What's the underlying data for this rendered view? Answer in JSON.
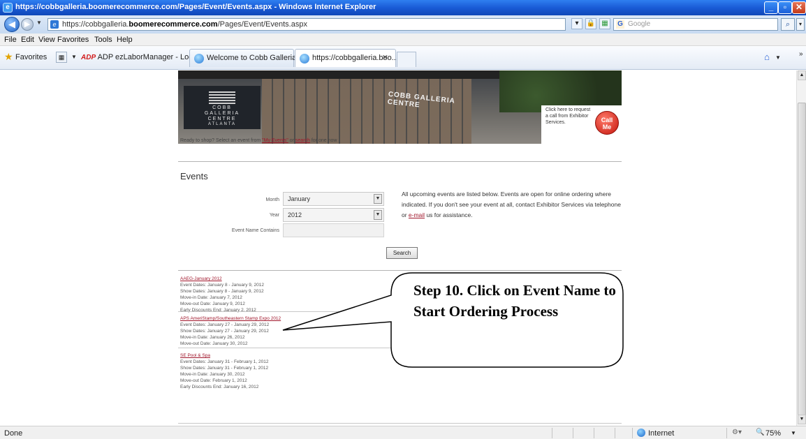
{
  "window": {
    "title": "https://cobbgalleria.boomerecommerce.com/Pages/Event/Events.aspx - Windows Internet Explorer"
  },
  "address_bar": {
    "url_prefix": "https://cobbgalleria.",
    "url_domain": "boomerecommerce.com",
    "url_path": "/Pages/Event/Events.aspx",
    "search_placeholder": "Google"
  },
  "menu": {
    "items": [
      "File",
      "Edit",
      "View",
      "Favorites",
      "Tools",
      "Help"
    ]
  },
  "favorites_bar": {
    "label": "Favorites",
    "links": [
      "ADP ezLaborManager - Login"
    ],
    "tabs": [
      "Welcome to Cobb Galleria Ce...",
      "https://cobbgalleria.boo..."
    ]
  },
  "banner": {
    "logo_line1": "COBB",
    "logo_line2": "GALLERIA",
    "logo_line3": "CENTRE",
    "logo_line4": "ATLANTA",
    "building_sign": "COBB GALLERIA CENTRE",
    "callme_text": "Click here to request a call from Exhibitor Services.",
    "callme_button_line1": "Call",
    "callme_button_line2": "Me"
  },
  "page": {
    "ready_prefix": "Ready to shop? Select an event from ",
    "ready_link1": "\"My Events\"",
    "ready_mid": " or ",
    "ready_link2": "search",
    "ready_suffix": " for one now",
    "events_heading": "Events",
    "month_label": "Month",
    "month_value": "January",
    "year_label": "Year",
    "year_value": "2012",
    "name_label": "Event Name Contains",
    "name_value": "",
    "info_before_link": "All upcoming events are listed below. Events are open for online ordering where indicated. If you don't see your event at all, contact Exhibitor Services via telephone or ",
    "info_link": "e-mail",
    "info_after_link": " us for assistance.",
    "search_button": "Search"
  },
  "events": [
    {
      "title": "AAEG-January 2012",
      "lines": [
        "Event Dates: January 8 - January 9, 2012",
        "Show Dates: January 8 - January 9, 2012",
        "Move-in Date: January 7, 2012",
        "Move-out Date: January 9, 2012",
        "Early Discounts End: January 2, 2012"
      ]
    },
    {
      "title": "APS AmeriStamp/Southeastern Stamp Expo 2012",
      "lines": [
        "Event Dates: January 27 - January 29, 2012",
        "Show Dates: January 27 - January 29, 2012",
        "Move-in Date: January 26, 2012",
        "Move-out Date: January 30, 2012"
      ]
    },
    {
      "title": "SE Pool & Spa",
      "lines": [
        "Event Dates: January 31 - February 1, 2012",
        "Show Dates: January 31 - February 1, 2012",
        "Move-in Date: January 30, 2012",
        "Move-out Date: February 1, 2012",
        "Early Discounts End: January 16, 2012"
      ]
    }
  ],
  "callout": {
    "text": "Step 10. Click on Event Name to Start Ordering Process"
  },
  "status_bar": {
    "status": "Done",
    "zone": "Internet",
    "zoom": "75%"
  }
}
